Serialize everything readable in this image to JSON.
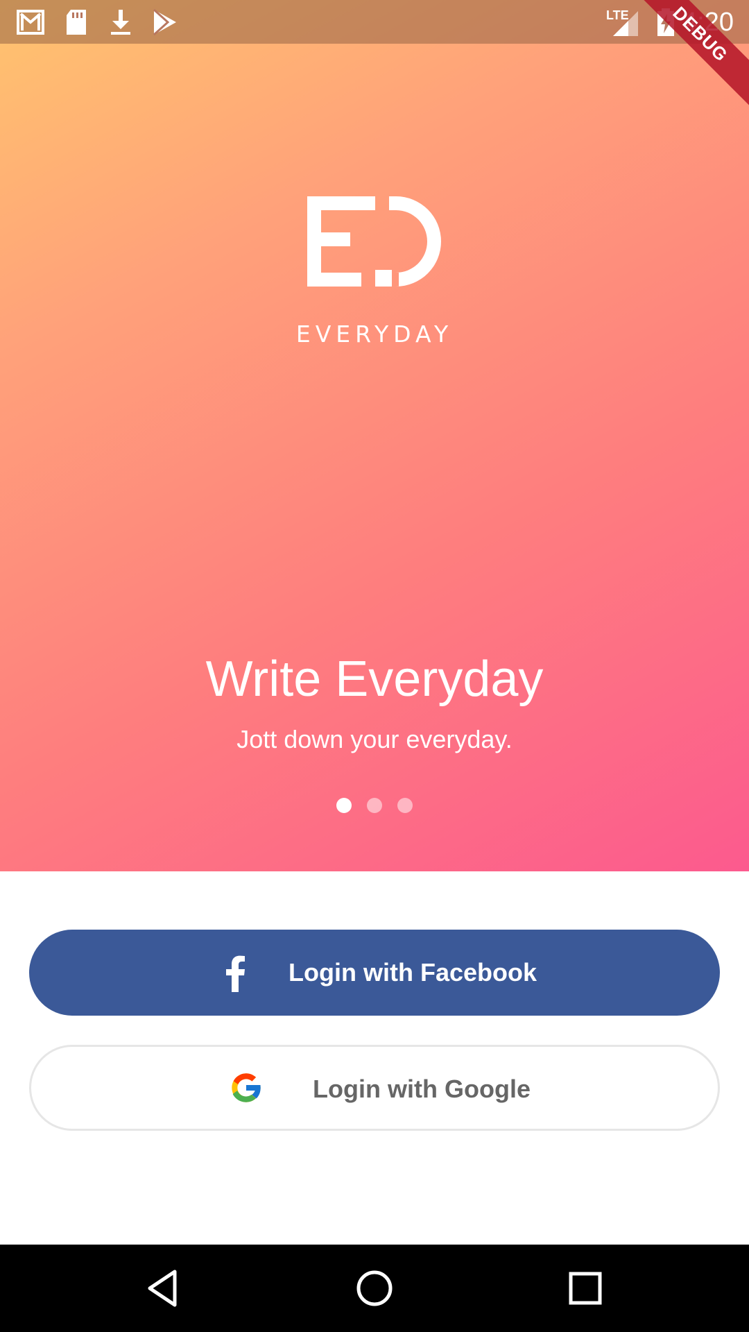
{
  "status_bar": {
    "time": "4:20",
    "network": "LTE",
    "icons": [
      "gmail-icon",
      "sd-card-icon",
      "download-icon",
      "play-store-icon",
      "signal-icon",
      "battery-charging-icon"
    ]
  },
  "debug_banner": "DEBUG",
  "hero": {
    "brand_name": "EVERYDAY",
    "slide_title": "Write Everyday",
    "slide_subtitle": "Jott down your everyday.",
    "page_count": 3,
    "current_page": 1,
    "gradient_colors": [
      "#FFC46E",
      "#FFA17A",
      "#FE7E7E",
      "#FC5A8E"
    ]
  },
  "buttons": {
    "facebook_label": "Login with Facebook",
    "google_label": "Login with Google",
    "facebook_color": "#3B5998"
  },
  "nav_bar": {
    "icons": [
      "back-icon",
      "home-icon",
      "recents-icon"
    ]
  }
}
